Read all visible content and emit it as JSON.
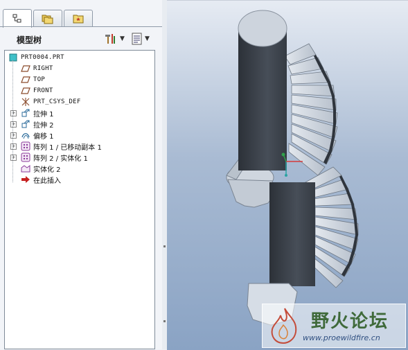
{
  "tabs": [
    {
      "name": "model-tree-tab",
      "icon": "tree-icon",
      "active": true
    },
    {
      "name": "folder-browser-tab",
      "icon": "folders-icon",
      "active": false
    },
    {
      "name": "favorites-tab",
      "icon": "favorites-icon",
      "active": false
    }
  ],
  "panel": {
    "title": "模型树",
    "tools": [
      {
        "name": "settings-tools-button",
        "icon": "hammer-icon"
      },
      {
        "name": "show-options-button",
        "icon": "list-icon"
      }
    ]
  },
  "tree": {
    "root": "PRT0004.PRT",
    "items": [
      {
        "label": "RIGHT",
        "icon": "datum-plane-icon",
        "expandable": false,
        "mono": true
      },
      {
        "label": "TOP",
        "icon": "datum-plane-icon",
        "expandable": false,
        "mono": true
      },
      {
        "label": "FRONT",
        "icon": "datum-plane-icon",
        "expandable": false,
        "mono": true
      },
      {
        "label": "PRT_CSYS_DEF",
        "icon": "csys-icon",
        "expandable": false,
        "mono": true
      },
      {
        "label": "拉伸 1",
        "icon": "extrude-icon",
        "expandable": true,
        "mono": false
      },
      {
        "label": "拉伸 2",
        "icon": "extrude-icon",
        "expandable": true,
        "mono": false
      },
      {
        "label": "偏移 1",
        "icon": "offset-icon",
        "expandable": true,
        "mono": false
      },
      {
        "label": "阵列 1 / 已移动副本 1",
        "icon": "pattern-icon",
        "expandable": true,
        "mono": false
      },
      {
        "label": "阵列 2 / 实体化 1",
        "icon": "pattern-icon",
        "expandable": true,
        "mono": false
      },
      {
        "label": "实体化 2",
        "icon": "solidify-icon",
        "expandable": false,
        "mono": false
      },
      {
        "label": "在此插入",
        "icon": "insert-arrow-icon",
        "expandable": false,
        "mono": false
      }
    ]
  },
  "watermark": {
    "title": "野火论坛",
    "url": "www.proewildfire.cn"
  },
  "colors": {
    "viewport_top": "#e6ebf3",
    "viewport_bottom": "#8aa3c4",
    "model_dark": "#3d434b",
    "model_light": "#c9d0da"
  }
}
